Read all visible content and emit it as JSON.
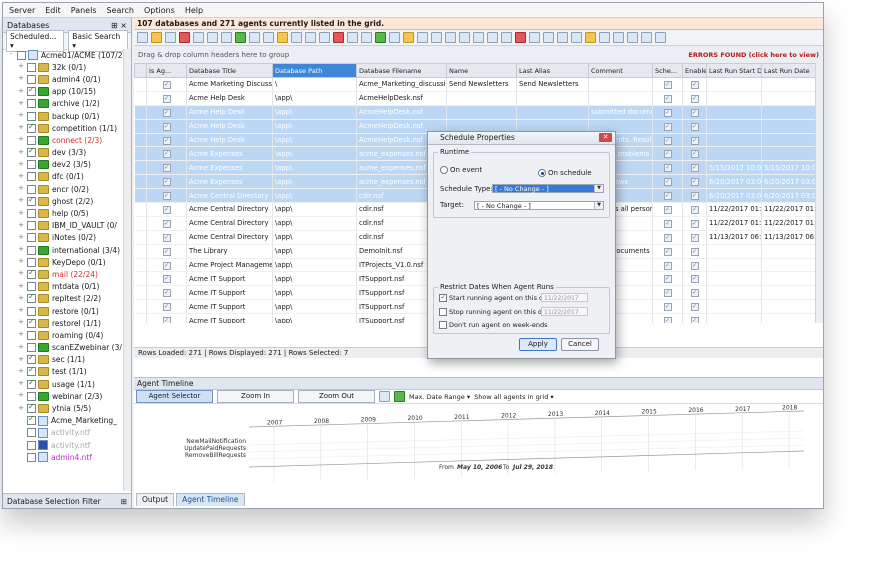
{
  "menu": [
    "Server",
    "Edit",
    "Panels",
    "Search",
    "Options",
    "Help"
  ],
  "left": {
    "title": "Databases",
    "filter_dropdown": "Scheduled...",
    "search_button": "Basic Search",
    "footer": "Database Selection Filter",
    "tree": [
      {
        "label": "Acme01/ACME (107/2",
        "type": "server",
        "indent": 0,
        "exp": "-"
      },
      {
        "label": "32k (0/1)",
        "type": "folder",
        "indent": 1,
        "exp": "+"
      },
      {
        "label": "admin4 (0/1)",
        "type": "folder",
        "indent": 1,
        "exp": "+"
      },
      {
        "label": "app (10/15)",
        "type": "folder",
        "indent": 1,
        "exp": "+",
        "checked": true,
        "green": true
      },
      {
        "label": "archive (1/2)",
        "type": "folder",
        "indent": 1,
        "exp": "+",
        "green": true
      },
      {
        "label": "backup (0/1)",
        "type": "folder",
        "indent": 1,
        "exp": "+"
      },
      {
        "label": "competition (1/1)",
        "type": "folder",
        "indent": 1,
        "exp": "+",
        "checked": true
      },
      {
        "label": "connect (2/3)",
        "type": "folder",
        "indent": 1,
        "exp": "+",
        "red": true,
        "green": true
      },
      {
        "label": "dev (3/3)",
        "type": "folder",
        "indent": 1,
        "exp": "+",
        "checked": true
      },
      {
        "label": "dev2 (3/5)",
        "type": "folder",
        "indent": 1,
        "exp": "+",
        "green": true
      },
      {
        "label": "dfc (0/1)",
        "type": "folder",
        "indent": 1,
        "exp": "+"
      },
      {
        "label": "encr (0/2)",
        "type": "folder",
        "indent": 1,
        "exp": "+"
      },
      {
        "label": "ghost (2/2)",
        "type": "folder",
        "indent": 1,
        "exp": "+",
        "checked": true
      },
      {
        "label": "help (0/5)",
        "type": "folder",
        "indent": 1,
        "exp": "+"
      },
      {
        "label": "IBM_ID_VAULT (0/",
        "type": "folder",
        "indent": 1,
        "exp": "+"
      },
      {
        "label": "iNotes (0/2)",
        "type": "folder",
        "indent": 1,
        "exp": "+"
      },
      {
        "label": "international (3/4)",
        "type": "folder",
        "indent": 1,
        "exp": "+",
        "green": true
      },
      {
        "label": "KeyDepo (0/1)",
        "type": "folder",
        "indent": 1,
        "exp": "+"
      },
      {
        "label": "mail (22/24)",
        "type": "folder",
        "indent": 1,
        "exp": "+",
        "red": true,
        "checked": true
      },
      {
        "label": "mtdata (0/1)",
        "type": "folder",
        "indent": 1,
        "exp": "+"
      },
      {
        "label": "repltest (2/2)",
        "type": "folder",
        "indent": 1,
        "exp": "+",
        "checked": true
      },
      {
        "label": "restore (0/1)",
        "type": "folder",
        "indent": 1,
        "exp": "+"
      },
      {
        "label": "restorel (1/1)",
        "type": "folder",
        "indent": 1,
        "exp": "+",
        "checked": true
      },
      {
        "label": "roaming (0/4)",
        "type": "folder",
        "indent": 1,
        "exp": "+"
      },
      {
        "label": "scanEZwebinar (3/",
        "type": "folder",
        "indent": 1,
        "exp": "+",
        "green": true
      },
      {
        "label": "sec (1/1)",
        "type": "folder",
        "indent": 1,
        "exp": "+",
        "checked": true
      },
      {
        "label": "test (1/1)",
        "type": "folder",
        "indent": 1,
        "exp": "+",
        "checked": true
      },
      {
        "label": "usage (1/1)",
        "type": "folder",
        "indent": 1,
        "exp": "+",
        "checked": true
      },
      {
        "label": "webinar (2/3)",
        "type": "folder",
        "indent": 1,
        "exp": "+",
        "green": true
      },
      {
        "label": "ytnia (5/5)",
        "type": "folder",
        "indent": 1,
        "exp": "+",
        "checked": true
      },
      {
        "label": "Acme_Marketing_",
        "type": "db",
        "indent": 1,
        "exp": "",
        "checked": true
      },
      {
        "label": "activity.ntf",
        "type": "db",
        "indent": 1,
        "exp": "",
        "grey": true
      },
      {
        "label": "activity.ntf",
        "type": "db",
        "indent": 1,
        "exp": "",
        "grey": true,
        "blue": true
      },
      {
        "label": "admin4.ntf",
        "type": "db",
        "indent": 1,
        "exp": "",
        "mag": true
      }
    ]
  },
  "main": {
    "banner": "107 databases and 271 agents currently listed in the grid.",
    "group_hint": "Drag & drop column headers here to group",
    "errors": "ERRORS FOUND (click here to view)",
    "columns": [
      "Is Ag...",
      "Database Title",
      "Database Path",
      "Database Filename",
      "Name",
      "Last Alias",
      "Comment",
      "Sche...",
      "Enable",
      "Last Run Start D...",
      "Last Run Date"
    ],
    "rows": [
      {
        "title": "Acme Marketing Discussion",
        "path": "\\",
        "file": "Acme_Marketing_discussio",
        "name": "Send Newsletters",
        "alias": "Send Newsletters",
        "comment": "",
        "start": "",
        "date": "",
        "sel": false
      },
      {
        "title": "Acme Help Desk",
        "path": "\\app\\",
        "file": "AcmeHelpDesk.nsf",
        "name": "",
        "alias": "",
        "comment": "",
        "start": "",
        "date": "",
        "sel": false
      },
      {
        "title": "Acme Help Desk",
        "path": "\\app\\",
        "file": "AcmeHelpDesk.nsf",
        "name": "",
        "alias": "",
        "comment": "submitted docume",
        "start": "",
        "date": "",
        "sel": true
      },
      {
        "title": "Acme Help Desk",
        "path": "\\app\\",
        "file": "AcmeHelpDesk.nsf",
        "name": "",
        "alias": "",
        "comment": "",
        "start": "",
        "date": "",
        "sel": true
      },
      {
        "title": "Acme Help Desk",
        "path": "\\app\\",
        "file": "AcmeHelpDesk.nsf",
        "name": "",
        "alias": "",
        "comment": "documents. Resolv",
        "start": "",
        "date": "",
        "sel": true
      },
      {
        "title": "Acme Expenses",
        "path": "\\app\\",
        "file": "acme_expenses.nsf",
        "name": "",
        "alias": "",
        "comment": "rmated problems o",
        "start": "",
        "date": "",
        "sel": true
      },
      {
        "title": "Acme Expenses",
        "path": "\\app\\",
        "file": "acme_expenses.nsf",
        "name": "",
        "alias": "",
        "comment": "",
        "start": "5/15/2017 10:00 PM",
        "date": "5/15/2017 10:0",
        "sel": true
      },
      {
        "title": "Acme Expenses",
        "path": "\\app\\",
        "file": "acme_expenses.nsf",
        "name": "",
        "alias": "",
        "comment": "cade News",
        "start": "6/20/2017 03:01 AM",
        "date": "6/20/2017 03:0",
        "sel": true
      },
      {
        "title": "Acme Central Directory",
        "path": "\\app\\",
        "file": "cdir.nsf",
        "name": "",
        "alias": "",
        "comment": "",
        "start": "6/20/2017 03:01 AM",
        "date": "6/20/2017 03:0",
        "sel": true
      },
      {
        "title": "Acme Central Directory",
        "path": "\\app\\",
        "file": "cdir.nsf",
        "name": "",
        "alias": "",
        "comment": "updates all person d",
        "start": "11/22/2017 01:01 AM",
        "date": "11/22/2017 01:0",
        "sel": false
      },
      {
        "title": "Acme Central Directory",
        "path": "\\app\\",
        "file": "cdir.nsf",
        "name": "",
        "alias": "",
        "comment": "",
        "start": "11/22/2017 01:01 AM",
        "date": "11/22/2017 01:0",
        "sel": false
      },
      {
        "title": "Acme Central Directory",
        "path": "\\app\\",
        "file": "cdir.nsf",
        "name": "",
        "alias": "",
        "comment": "",
        "start": "11/13/2017 06:44 AM",
        "date": "11/13/2017 06:4",
        "sel": false
      },
      {
        "title": "The Library",
        "path": "\\app\\",
        "file": "DemoInit.nsf",
        "name": "",
        "alias": "",
        "comment": "those documents wi",
        "start": "",
        "date": "",
        "sel": false
      },
      {
        "title": "Acme Project Management",
        "path": "\\app\\",
        "file": "ITProjects_V1.0.nsf",
        "name": "",
        "alias": "",
        "comment": "",
        "start": "",
        "date": "",
        "sel": false
      },
      {
        "title": "Acme IT Support",
        "path": "\\app\\",
        "file": "ITSupport.nsf",
        "name": "",
        "alias": "",
        "comment": "",
        "start": "",
        "date": "",
        "sel": false
      },
      {
        "title": "Acme IT Support",
        "path": "\\app\\",
        "file": "ITSupport.nsf",
        "name": "",
        "alias": "",
        "comment": "",
        "start": "",
        "date": "",
        "sel": false
      },
      {
        "title": "Acme IT Support",
        "path": "\\app\\",
        "file": "ITSupport.nsf",
        "name": "",
        "alias": "",
        "comment": "",
        "start": "",
        "date": "",
        "sel": false
      },
      {
        "title": "Acme IT Support",
        "path": "\\app\\",
        "file": "ITSupport.nsf",
        "name": "",
        "alias": "",
        "comment": "",
        "start": "",
        "date": "",
        "sel": false
      }
    ],
    "status": "Rows Loaded: 271  |  Rows Displayed: 271  |  Rows Selected: 7"
  },
  "timeline": {
    "title": "Agent Timeline",
    "agent_selector": "Agent Selector",
    "zoom_in": "Zoom In",
    "zoom_out": "Zoom Out",
    "max_date_range": "Max. Date Range",
    "show_agents": "Show all agents in grid",
    "years": [
      "2007",
      "2008",
      "2009",
      "2010",
      "2011",
      "2012",
      "2013",
      "2014",
      "2015",
      "2016",
      "2017",
      "2018"
    ],
    "agents": [
      "NewMailNotification",
      "UpdatePaidRequests",
      "RemoveBillRequests"
    ],
    "range_from_label": "From",
    "range_from": "May 10, 2006",
    "range_to_label": "To",
    "range_to": "Jul 29, 2018"
  },
  "tabs": [
    "Output",
    "Agent Timeline"
  ],
  "dialog": {
    "title": "Schedule Properties",
    "runtime_label": "Runtime",
    "on_event": "On event",
    "on_schedule": "On schedule",
    "schedule_type_label": "Schedule Type:",
    "schedule_type_value": "[ - No Change - ]",
    "target_label": "Target:",
    "target_value": "[ - No Change - ]",
    "restrict_label": "Restrict Dates When Agent Runs",
    "start_label": "Start running agent on this date",
    "start_date": "11/22/2017",
    "stop_label": "Stop running agent on this date",
    "stop_date": "11/22/2017",
    "weekends_label": "Don't run agent on week-ends",
    "apply": "Apply",
    "cancel": "Cancel"
  }
}
